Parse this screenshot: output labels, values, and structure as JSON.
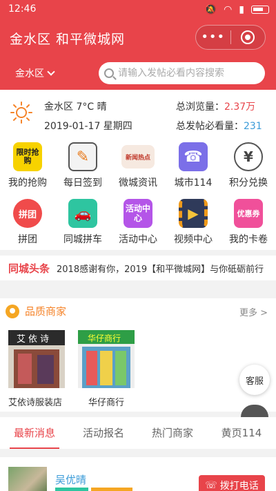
{
  "status": {
    "time": "12:46"
  },
  "header": {
    "title": "金水区 和平微城网",
    "capsule_menu": "•••",
    "district": "金水区",
    "search_placeholder": "请输入发帖必看内容搜索"
  },
  "weather": {
    "summary": "金水区 7°C 晴",
    "date": "2019-01-17 星期四",
    "views_label": "总浏览量：",
    "views_value": "2.37万",
    "posts_label": "总发帖必看量：",
    "posts_value": "231"
  },
  "grid_row1": [
    {
      "label": "我的抢购",
      "icon_text": "限时抢购",
      "color": "#f7d200"
    },
    {
      "label": "每日签到",
      "icon_text": "✎",
      "color": "#555555"
    },
    {
      "label": "微城资讯",
      "icon_text": "新闻热点",
      "color": "#d83c3c"
    },
    {
      "label": "城市114",
      "icon_text": "☎",
      "color": "#7b6fe8"
    },
    {
      "label": "积分兑换",
      "icon_text": "¥",
      "color": "#666666"
    }
  ],
  "grid_row2": [
    {
      "label": "拼团",
      "icon_text": "拼团",
      "color": "#f04b4b"
    },
    {
      "label": "同城拼车",
      "icon_text": "🚗",
      "color": "#2ec5a0"
    },
    {
      "label": "活动中心",
      "icon_text": "活动中心",
      "color": "#b455e8"
    },
    {
      "label": "视频中心",
      "icon_text": "▶",
      "color": "#f09a1a"
    },
    {
      "label": "我的卡卷",
      "icon_text": "优惠券",
      "color": "#f0509a"
    }
  ],
  "headline": {
    "title": "同城头条",
    "text": "2018感谢有你，2019【和平微城网】与你砥砺前行"
  },
  "merchants": {
    "title": "品质商家",
    "more": "更多 >",
    "items": [
      {
        "name": "艾依诗服装店",
        "sign": "艾依诗"
      },
      {
        "name": "华仔商行",
        "sign": "华仔商行"
      }
    ]
  },
  "float": {
    "service": "客服"
  },
  "tabs": [
    "最新消息",
    "活动报名",
    "热门商家",
    "黄页114"
  ],
  "post": {
    "name": "吴优晴",
    "call": "拨打电话"
  },
  "colors": {
    "brand": "#e8444a",
    "accent_blue": "#3a9bd8",
    "accent_orange": "#f5842a"
  }
}
